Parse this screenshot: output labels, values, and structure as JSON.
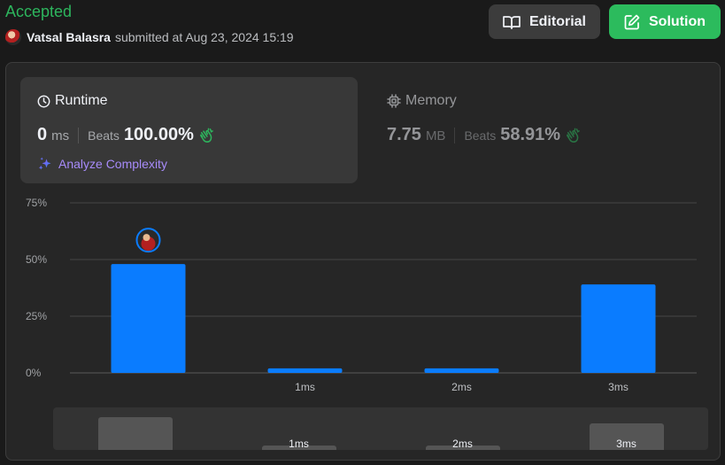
{
  "header": {
    "status": "Accepted",
    "user_name": "Vatsal Balasra",
    "submitted_text": "submitted at Aug 23, 2024 15:19",
    "editorial_label": "Editorial",
    "solution_label": "Solution"
  },
  "runtime": {
    "title": "Runtime",
    "value": "0",
    "unit": "ms",
    "beats_label": "Beats",
    "beats_pct": "100.00%",
    "analyze_label": "Analyze Complexity"
  },
  "memory": {
    "title": "Memory",
    "value": "7.75",
    "unit": "MB",
    "beats_label": "Beats",
    "beats_pct": "58.91%"
  },
  "colors": {
    "accepted": "#2db55d",
    "solution_btn": "#2cbb5d",
    "bar": "#0a7cff",
    "analyze": "#a78bfa",
    "clap": "#2db55d"
  },
  "icons": {
    "editorial": "book-open-icon",
    "solution": "edit-icon",
    "runtime": "clock-icon",
    "memory": "chip-icon",
    "analyze": "sparkle-icon",
    "beats": "clap-icon"
  },
  "chart_data": {
    "type": "bar",
    "categories": [
      "",
      "1ms",
      "2ms",
      "3ms"
    ],
    "values": [
      48,
      2,
      2,
      39
    ],
    "ylim": [
      0,
      75
    ],
    "yticks": [
      "0%",
      "25%",
      "50%",
      "75%"
    ],
    "ytick_values": [
      0,
      25,
      50,
      75
    ],
    "grid": true,
    "highlighted_index": 0
  },
  "mini_chart": {
    "labels": [
      "1ms",
      "2ms",
      "3ms"
    ]
  }
}
